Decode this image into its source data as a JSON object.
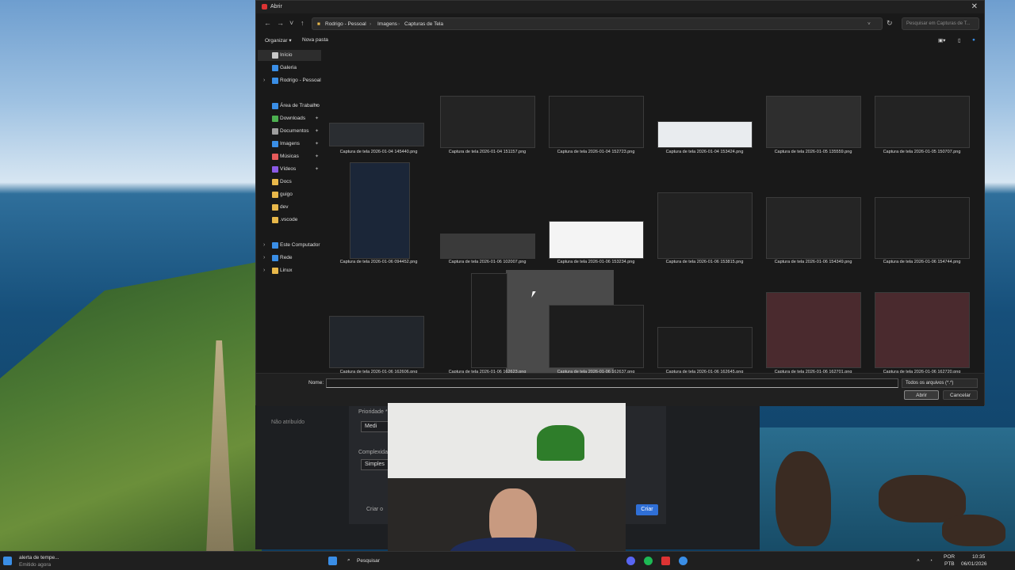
{
  "dialog": {
    "title": "Abrir",
    "breadcrumb": [
      "Rodrigo - Pessoal",
      "Imagens",
      "Capturas de Tela"
    ],
    "search_placeholder": "Pesquisar em Capturas de T...",
    "toolbar": {
      "organize": "Organizar ▾",
      "new_folder": "Nova pasta"
    },
    "sidebar": [
      {
        "label": "Início",
        "icon": "home-icon",
        "color": "#c8c8c8",
        "active": true,
        "chevron": false,
        "pin": false
      },
      {
        "label": "Galeria",
        "icon": "gallery-icon",
        "color": "#3a8ee6",
        "chevron": false,
        "pin": false
      },
      {
        "label": "Rodrigo - Pessoal",
        "icon": "cloud-icon",
        "color": "#3a8ee6",
        "chevron": true,
        "pin": false
      },
      {
        "label": "Área de Trabalho",
        "icon": "desktop-icon",
        "color": "#3a8ee6",
        "chevron": false,
        "pin": true
      },
      {
        "label": "Downloads",
        "icon": "download-icon",
        "color": "#4caf50",
        "chevron": false,
        "pin": true
      },
      {
        "label": "Documentos",
        "icon": "document-icon",
        "color": "#9e9e9e",
        "chevron": false,
        "pin": true
      },
      {
        "label": "Imagens",
        "icon": "image-icon",
        "color": "#3a8ee6",
        "chevron": false,
        "pin": true
      },
      {
        "label": "Músicas",
        "icon": "music-icon",
        "color": "#e55a5a",
        "chevron": false,
        "pin": true
      },
      {
        "label": "Vídeos",
        "icon": "video-icon",
        "color": "#8a5ae5",
        "chevron": false,
        "pin": true
      },
      {
        "label": "Docs",
        "icon": "folder-icon",
        "color": "#e8b84a",
        "chevron": false,
        "pin": false
      },
      {
        "label": "guigo",
        "icon": "folder-icon",
        "color": "#e8b84a",
        "chevron": false,
        "pin": false
      },
      {
        "label": "dev",
        "icon": "folder-icon",
        "color": "#e8b84a",
        "chevron": false,
        "pin": false
      },
      {
        "label": ".vscode",
        "icon": "folder-icon",
        "color": "#e8b84a",
        "chevron": false,
        "pin": false
      },
      {
        "label": "Este Computador",
        "icon": "computer-icon",
        "color": "#3a8ee6",
        "chevron": true,
        "pin": false
      },
      {
        "label": "Rede",
        "icon": "network-icon",
        "color": "#3a8ee6",
        "chevron": true,
        "pin": false
      },
      {
        "label": "Linux",
        "icon": "linux-icon",
        "color": "#e8b84a",
        "chevron": true,
        "pin": false
      }
    ],
    "files": [
      "Captura de tela 2026-01-04 145440.png",
      "Captura de tela 2026-01-04 151157.png",
      "Captura de tela 2026-01-04 152723.png",
      "Captura de tela 2026-01-04 153424.png",
      "Captura de tela 2026-01-05 135559.png",
      "Captura de tela 2026-01-05 150707.png",
      "Captura de tela 2026-01-06 094452.png",
      "Captura de tela 2026-01-06 102007.png",
      "Captura de tela 2026-01-06 153234.png",
      "Captura de tela 2026-01-06 153815.png",
      "Captura de tela 2026-01-06 154349.png",
      "Captura de tela 2026-01-06 154744.png",
      "Captura de tela 2026-01-06 162606.png",
      "Captura de tela 2026-01-06 162623.png",
      "Captura de tela 2026-01-06 162637.png",
      "Captura de tela 2026-01-06 162645.png",
      "Captura de tela 2026-01-06 162701.png",
      "Captura de tela 2026-01-06 162720.png"
    ],
    "name_label": "Nome:",
    "name_value": "",
    "file_type": "Todos os arquivos (*.*)",
    "open_button": "Abrir",
    "cancel_button": "Cancelar"
  },
  "background_app": {
    "priority_label": "Prioridade *",
    "priority_value": "Medi",
    "complexity_label": "Complexida",
    "complexity_value": "Simples",
    "unassigned": "Não atribuído",
    "create_checkbox": "Criar o",
    "create_button": "Criar"
  },
  "taskbar": {
    "notification_title": "alerta de tempe...",
    "notification_sub": "Emitido agora",
    "search": "Pesquisar",
    "lang": "POR",
    "layout": "PTB",
    "time": "10:35",
    "date": "06/01/2026"
  }
}
